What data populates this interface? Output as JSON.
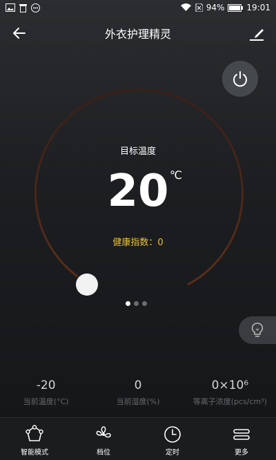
{
  "status_bar": {
    "battery": "94%",
    "time": "19:01"
  },
  "app_bar": {
    "title": "外衣护理精灵"
  },
  "dial": {
    "target_label": "目标温度",
    "temperature": "20",
    "unit": "℃",
    "health_index": "健康指数：0"
  },
  "pager": {
    "pages": 3,
    "active": 0
  },
  "stats": [
    {
      "value": "-20",
      "label": "当前温度(°C)"
    },
    {
      "value": "0",
      "label": "当前湿度(%)"
    },
    {
      "value": "0×10⁶",
      "label": "等离子浓度(pcs/cm³)"
    }
  ],
  "tabs": [
    {
      "label": "智能模式",
      "icon": "smart-mode-icon"
    },
    {
      "label": "档位",
      "icon": "fan-icon"
    },
    {
      "label": "定时",
      "icon": "clock-icon"
    },
    {
      "label": "更多",
      "icon": "more-icon"
    }
  ],
  "colors": {
    "accent": "#e9c23a",
    "arc": "#4a2a1e"
  }
}
